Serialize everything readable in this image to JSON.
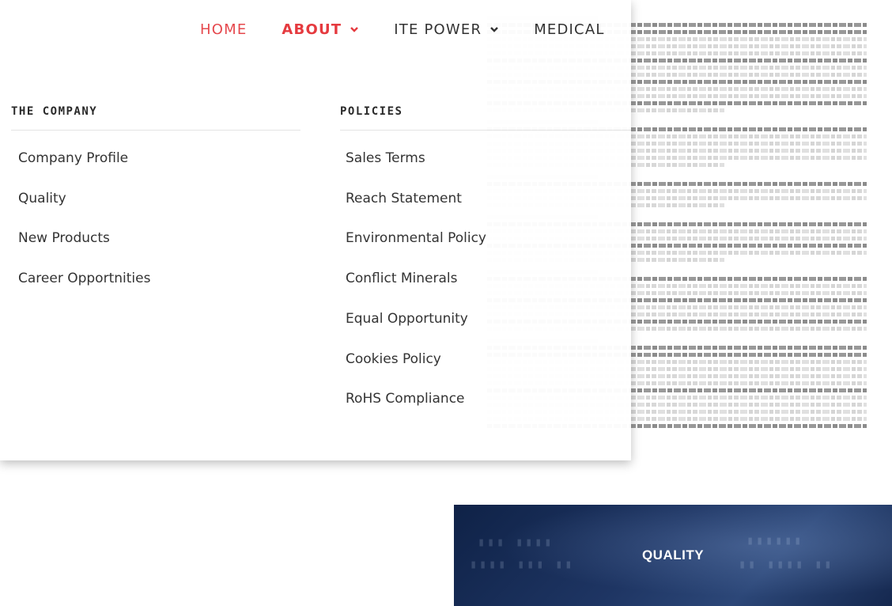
{
  "nav": {
    "items": [
      {
        "label": "HOME"
      },
      {
        "label": "ABOUT"
      },
      {
        "label": "ITE POWER"
      },
      {
        "label": "MEDICAL"
      }
    ]
  },
  "menu": {
    "company": {
      "heading": "THE COMPANY",
      "links": [
        "Company Profile",
        "Quality",
        "New Products",
        "Career Opportnities"
      ]
    },
    "policies": {
      "heading": "POLICIES",
      "links": [
        "Sales Terms",
        "Reach Statement",
        "Environmental Policy",
        "Conflict Minerals",
        "Equal Opportunity",
        "Cookies Policy",
        "RoHS Compliance"
      ]
    }
  },
  "banner": {
    "title": "QUALITY"
  },
  "colors": {
    "accent": "#e53a3f",
    "banner": "#1e3563",
    "text": "#333333"
  }
}
